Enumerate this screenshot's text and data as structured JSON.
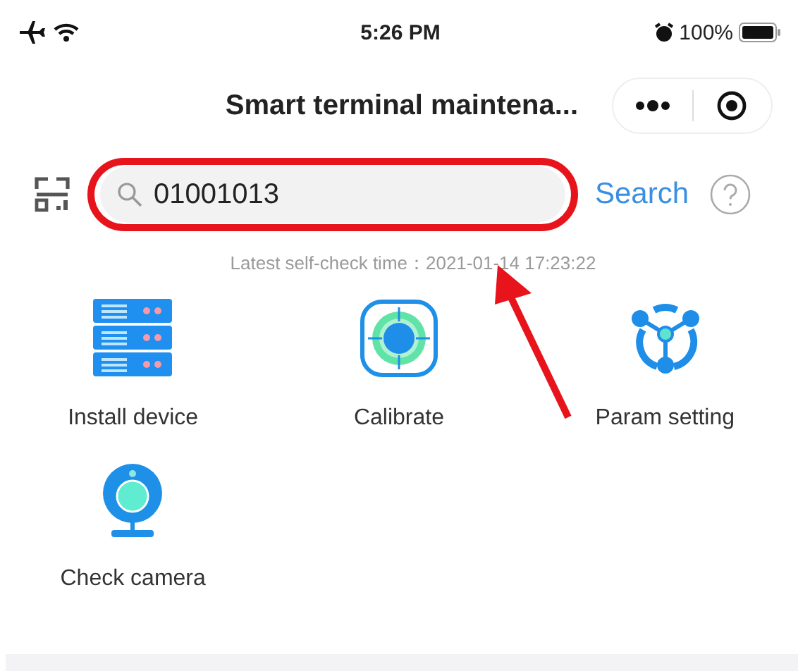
{
  "status_bar": {
    "time": "5:26 PM",
    "battery": "100%"
  },
  "title_bar": {
    "title": "Smart terminal maintena..."
  },
  "search": {
    "value": "01001013",
    "button": "Search"
  },
  "self_check": "Latest self-check time：2021-01-14 17:23:22",
  "functions": [
    {
      "label": "Install device",
      "kind": "server"
    },
    {
      "label": "Calibrate",
      "kind": "target"
    },
    {
      "label": "Param setting",
      "kind": "network"
    },
    {
      "label": "Check camera",
      "kind": "camera"
    }
  ]
}
